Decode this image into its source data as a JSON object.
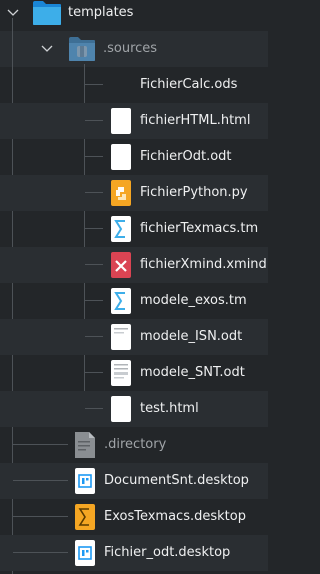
{
  "tree": {
    "root": {
      "label": "templates",
      "icon": "folder-blue-icon",
      "expanded": true
    },
    "sources": {
      "label": ".sources",
      "icon": "folder-hidden-icon",
      "expanded": true
    },
    "source_files": [
      {
        "label": "FichierCalc.ods",
        "icon": "blank-icon"
      },
      {
        "label": "fichierHTML.html",
        "icon": "html-file-icon"
      },
      {
        "label": "FichierOdt.odt",
        "icon": "odt-file-icon"
      },
      {
        "label": "FichierPython.py",
        "icon": "python-file-icon"
      },
      {
        "label": "fichierTexmacs.tm",
        "icon": "texmacs-file-icon"
      },
      {
        "label": "fichierXmind.xmind",
        "icon": "xmind-file-icon"
      },
      {
        "label": "modele_exos.tm",
        "icon": "texmacs-file-icon"
      },
      {
        "label": "modele_ISN.odt",
        "icon": "odt-document-icon"
      },
      {
        "label": "modele_SNT.odt",
        "icon": "odt-document-icon"
      },
      {
        "label": "test.html",
        "icon": "html-file-icon"
      }
    ],
    "root_files": [
      {
        "label": ".directory",
        "icon": "text-file-icon",
        "dimmed": true
      },
      {
        "label": "DocumentSnt.desktop",
        "icon": "desktop-file-icon"
      },
      {
        "label": "ExosTexmacs.desktop",
        "icon": "texmacs-desktop-icon"
      },
      {
        "label": "Fichier_odt.desktop",
        "icon": "desktop-file-icon"
      }
    ]
  },
  "colors": {
    "background": "#232629",
    "alternate_row": "#2a2e32",
    "folder_blue": "#1d99f3",
    "python_orange": "#f5a623",
    "xmind_red": "#da4453",
    "texmacs_blue": "#3daee9"
  }
}
